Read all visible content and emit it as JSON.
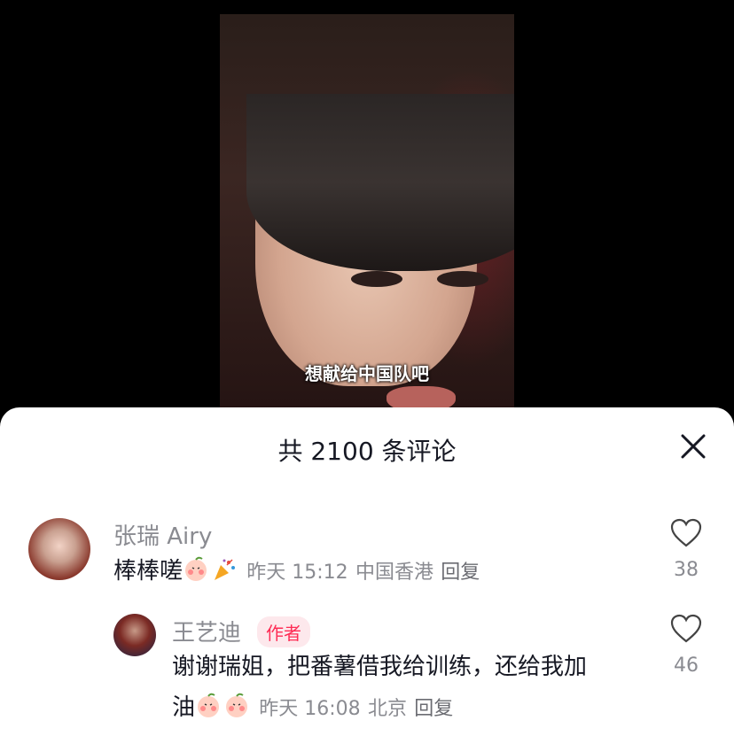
{
  "video": {
    "subtitle": "想献给中国队吧"
  },
  "comments_panel": {
    "title": "共 2100 条评论",
    "close_icon": "close-icon"
  },
  "comments": [
    {
      "username": "张瑞 Airy",
      "text": "棒棒嗟",
      "emojis": [
        "peach-blush-emoji",
        "party-popper-emoji"
      ],
      "time": "昨天 15:12",
      "location": "中国香港",
      "reply_label": "回复",
      "likes": "38"
    }
  ],
  "reply": {
    "username": "王艺迪",
    "badge": "作者",
    "text_line1": "谢谢瑞姐，把番薯借我给训练，还给我加",
    "text_line2": "油",
    "emojis": [
      "peach-blush-emoji",
      "peach-blush-emoji"
    ],
    "time": "昨天 16:08",
    "location": "北京",
    "reply_label": "回复",
    "likes": "46"
  },
  "colors": {
    "accent": "#fe2c55",
    "muted": "#8a8b91",
    "text": "#161823"
  }
}
